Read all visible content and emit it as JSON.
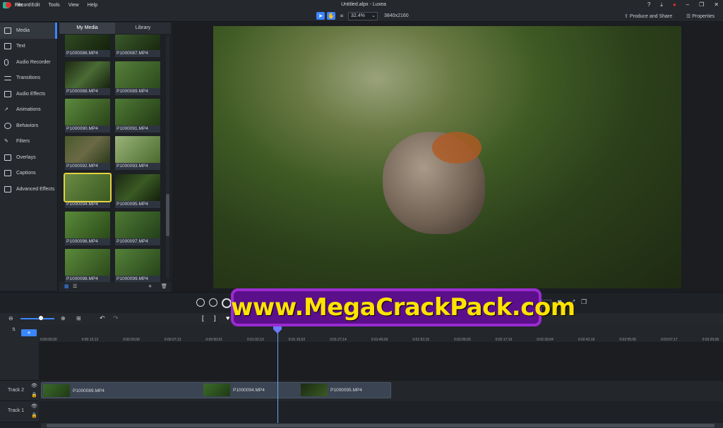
{
  "menu": [
    "File",
    "Edit",
    "Tools",
    "View",
    "Help"
  ],
  "window_title": "Untitled.alpx - Luxea",
  "toolbar": {
    "record": "Record",
    "zoom": "32.4%",
    "dims": "3840x2160",
    "produce": "Produce and Share",
    "properties": "Properties"
  },
  "sidebar": [
    {
      "label": "Media",
      "icon": "media-icon",
      "active": true
    },
    {
      "label": "Text",
      "icon": "text-icon"
    },
    {
      "label": "Audio Recorder",
      "icon": "microphone-icon"
    },
    {
      "label": "Transitions",
      "icon": "transitions-icon"
    },
    {
      "label": "Audio Effects",
      "icon": "speaker-icon"
    },
    {
      "label": "Animations",
      "icon": "arrow-icon"
    },
    {
      "label": "Behaviors",
      "icon": "behaviors-icon"
    },
    {
      "label": "Filters",
      "icon": "wand-icon"
    },
    {
      "label": "Overlays",
      "icon": "overlays-icon"
    },
    {
      "label": "Captions",
      "icon": "captions-icon"
    },
    {
      "label": "Advanced Effects",
      "icon": "effects-icon"
    }
  ],
  "media_tabs": [
    "My Media",
    "Library"
  ],
  "media": [
    "P1000086.MP4",
    "P1000087.MP4",
    "P1000088.MP4",
    "P1000089.MP4",
    "P1000090.MP4",
    "P1000091.MP4",
    "P1000092.MP4",
    "P1000093.MP4",
    "P1000094.MP4",
    "P1000095.MP4",
    "P1000096.MP4",
    "P1000097.MP4",
    "P1000098.MP4",
    "P1000099.MP4"
  ],
  "selected_media": "P1000094.MP4",
  "ruler": [
    "0:00:00;00",
    "0:00:12;12",
    "0:00:25;00",
    "0:00:37;13",
    "0:00:50;01",
    "0:01:02;13",
    "0:01:15;02",
    "0:01:27;14",
    "0:01:40;03",
    "0:01:52;15",
    "0:02:05;03",
    "0:02:17;16",
    "0:02:30;04",
    "0:02:42;16",
    "0:02:55;05",
    "0:03:07;17",
    "0:03:20;06"
  ],
  "tracks": [
    {
      "name": "Track 2",
      "clips": [
        "P1000089.MP4",
        "P1000094.MP4",
        "P1000095.MP4"
      ]
    },
    {
      "name": "Track 1",
      "clips": []
    }
  ],
  "watermark": "www.MegaCrackPack.com"
}
